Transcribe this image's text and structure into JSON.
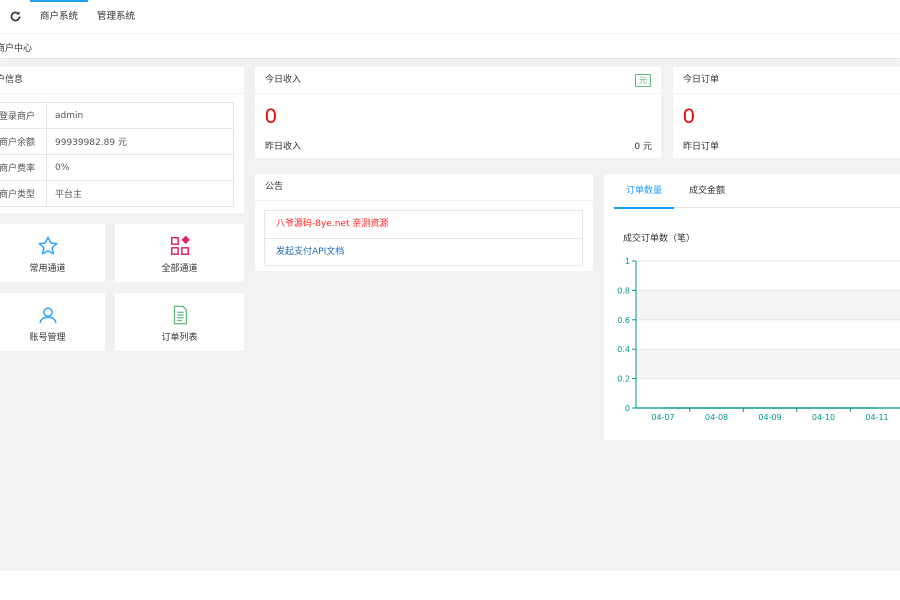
{
  "header": {
    "nav": [
      "商户系统",
      "管理系统"
    ]
  },
  "breadcrumb": "商户中心",
  "merchant_info": {
    "title": "户信息",
    "rows": [
      {
        "key": "登录商户",
        "value": "admin"
      },
      {
        "key": "商户余额",
        "value": "99939982.89 元"
      },
      {
        "key": "商户费率",
        "value": "0%"
      },
      {
        "key": "商户类型",
        "value": "平台主"
      }
    ]
  },
  "income": {
    "title": "今日收入",
    "tag": "元",
    "value": "0",
    "sub_label": "昨日收入",
    "sub_value": "0 元"
  },
  "orders": {
    "title": "今日订单",
    "value": "0",
    "sub_label": "昨日订单"
  },
  "shortcuts": [
    {
      "label": "常用通道",
      "icon": "star-icon"
    },
    {
      "label": "全部通道",
      "icon": "grid-apps-icon"
    },
    {
      "label": "账号管理",
      "icon": "user-icon"
    },
    {
      "label": "订单列表",
      "icon": "document-list-icon"
    }
  ],
  "notice": {
    "title": "公告",
    "items": [
      {
        "text": "八爷源码-8ye.net 亲测资源",
        "color": "#ff2222"
      },
      {
        "text": "发起支付API文档",
        "color": "#1e6ab8"
      }
    ]
  },
  "chart_tabs": [
    "订单数量",
    "成交金额"
  ],
  "colors": {
    "accent": "#1e9fff",
    "highlight": "#ff0000",
    "chart_line": "#009688"
  },
  "chart_data": {
    "type": "line",
    "title": "成交订单数（笔）",
    "x": [
      "04-07",
      "04-08",
      "04-09",
      "04-10",
      "04-11"
    ],
    "series": [
      {
        "values": [
          0,
          0,
          0,
          0,
          0
        ]
      }
    ],
    "ylim": [
      0,
      1
    ],
    "yticks": [
      "0",
      "0.2",
      "0.4",
      "0.6",
      "0.8",
      "1"
    ],
    "grid": true
  }
}
